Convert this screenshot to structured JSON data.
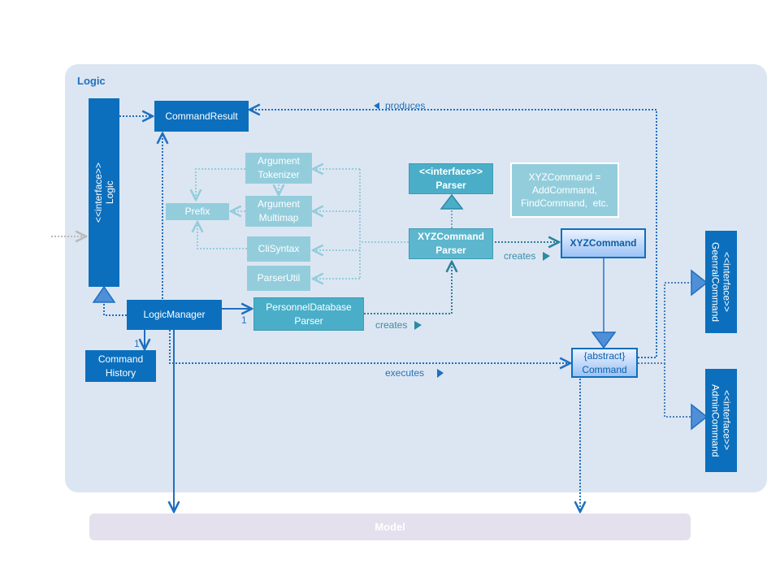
{
  "diagram": {
    "package_title": "Logic",
    "external_package": "Model",
    "classes": {
      "command_result": "CommandResult",
      "logic_interface": "<<interface>>\nLogic",
      "logic_manager": "LogicManager",
      "command_history": "Command\nHistory",
      "argument_tokenizer": "Argument\nTokenizer",
      "argument_multimap": "Argument\nMultimap",
      "prefix": "Prefix",
      "cli_syntax": "CliSyntax",
      "parser_util": "ParserUtil",
      "personnel_database_parser": "PersonnelDatabase\nParser",
      "parser_interface": "<<interface>>\nParser",
      "xyz_command_parser": "XYZCommand\nParser",
      "xyz_command": "XYZCommand",
      "abstract_command": "{abstract}\nCommand",
      "general_command": "<<interface>>\nGeenralCommand",
      "admin_command": "<<interface>>\nAdminCommand"
    },
    "note": "XYZCommand =\nAddCommand,\nFindCommand,  etc.",
    "edge_labels": {
      "produces": "produces",
      "creates_1": "creates",
      "creates_2": "creates",
      "executes": "executes",
      "mult_parser": "1",
      "mult_history": "1"
    },
    "colors": {
      "frame_bg": "#dce6f2",
      "dark_blue": "#0b6fbd",
      "teal": "#4aaec8",
      "light_teal": "#93cddc",
      "model_bg": "#e4e0ed"
    }
  }
}
